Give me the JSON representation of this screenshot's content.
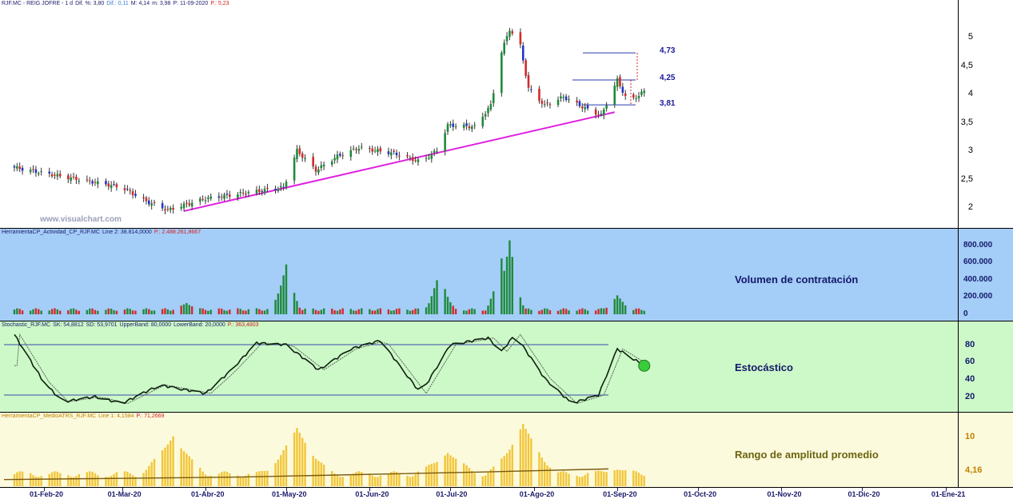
{
  "price_panel": {
    "header": [
      {
        "text": "RJF.MC - REIG JOFRE - 1 d",
        "color": "#1a1a6a"
      },
      {
        "text": "Dif. %: 3,80",
        "color": "#1a1a6a"
      },
      {
        "text": "Dif.: 0,11",
        "color": "#3a7ad0"
      },
      {
        "text": "M: 4,14",
        "color": "#1a1a6a"
      },
      {
        "text": "m: 3,98",
        "color": "#1a1a6a"
      },
      {
        "text": "P: 11-09-2020",
        "color": "#1a1a6a"
      },
      {
        "text": "P.: 5,23",
        "color": "#d02020"
      }
    ],
    "watermark": "www.visualchart.com",
    "levels": [
      "4,73",
      "4,25",
      "3,81"
    ],
    "y_ticks": [
      "5",
      "4,5",
      "4",
      "3,5",
      "3",
      "2,5",
      "2"
    ]
  },
  "volume_panel": {
    "header": [
      {
        "text": "HerramientaCP_Actividad_CP_RJF.MC",
        "color": "#1a1a6a"
      },
      {
        "text": "Line 2: 38.814,0000",
        "color": "#1a1a6a"
      },
      {
        "text": "P.: 2.488.261,8667",
        "color": "#d02020"
      }
    ],
    "title": "Volumen de contratación",
    "y_ticks": [
      "800.000",
      "600.000",
      "400.000",
      "200.000",
      "0"
    ]
  },
  "stoch_panel": {
    "header": [
      {
        "text": "Stochastic_RJF.MC",
        "color": "#1a1a6a"
      },
      {
        "text": "SK: 54,8812",
        "color": "#1a1a6a"
      },
      {
        "text": "SD: 53,9701",
        "color": "#1a1a6a"
      },
      {
        "text": "UpperBand: 80,0000",
        "color": "#1a1a6a"
      },
      {
        "text": "LowerBand: 20,0000",
        "color": "#1a1a6a"
      },
      {
        "text": "P.: 363,4803",
        "color": "#d02020"
      }
    ],
    "title": "Estocástico",
    "y_ticks": [
      "80",
      "60",
      "40",
      "20"
    ]
  },
  "atr_panel": {
    "header": [
      {
        "text": "HerramientaCP_MedioATRS_RJF.MC",
        "color": "#c08000"
      },
      {
        "text": "Line 1: 4,1584",
        "color": "#c08000"
      },
      {
        "text": "P.: 71,2669",
        "color": "#d02020"
      }
    ],
    "title": "Rango de amplitud promedio",
    "y_ticks": [
      "10",
      "4,16"
    ]
  },
  "x_axis": {
    "labels": [
      "01-Feb-20",
      "01-Mar-20",
      "01-Abr-20",
      "01-May-20",
      "01-Jun-20",
      "01-Jul-20",
      "01-Ago-20",
      "01-Sep-20",
      "01-Oct-20",
      "01-Nov-20",
      "01-Dic-20",
      "01-Ene-21"
    ],
    "year_marker": "2021"
  },
  "chart_data": [
    {
      "type": "candlestick",
      "title": "RJF.MC - REIG JOFRE - 1 d",
      "xlabel": "",
      "ylabel": "",
      "ylim": [
        1.7,
        5.3
      ],
      "x_range": [
        "2020-01-21",
        "2020-09-11"
      ],
      "close_path": [
        [
          "2020-01-21",
          2.7
        ],
        [
          "2020-02-01",
          2.6
        ],
        [
          "2020-02-15",
          2.48
        ],
        [
          "2020-03-01",
          2.35
        ],
        [
          "2020-03-10",
          2.1
        ],
        [
          "2020-03-18",
          1.95
        ],
        [
          "2020-04-01",
          2.15
        ],
        [
          "2020-04-20",
          2.28
        ],
        [
          "2020-04-30",
          2.35
        ],
        [
          "2020-05-05",
          3.0
        ],
        [
          "2020-05-12",
          2.65
        ],
        [
          "2020-05-20",
          2.9
        ],
        [
          "2020-05-28",
          3.05
        ],
        [
          "2020-06-10",
          2.95
        ],
        [
          "2020-06-20",
          2.8
        ],
        [
          "2020-06-26",
          3.0
        ],
        [
          "2020-06-30",
          3.45
        ],
        [
          "2020-07-10",
          3.42
        ],
        [
          "2020-07-16",
          3.8
        ],
        [
          "2020-07-20",
          4.75
        ],
        [
          "2020-07-23",
          5.15
        ],
        [
          "2020-07-27",
          4.85
        ],
        [
          "2020-07-30",
          4.1
        ],
        [
          "2020-08-05",
          3.8
        ],
        [
          "2020-08-12",
          3.95
        ],
        [
          "2020-08-20",
          3.75
        ],
        [
          "2020-08-26",
          3.62
        ],
        [
          "2020-09-01",
          4.25
        ],
        [
          "2020-09-05",
          3.85
        ],
        [
          "2020-09-11",
          4.05
        ]
      ],
      "trendline": [
        [
          "2020-03-24",
          1.93
        ],
        [
          "2020-08-31",
          3.68
        ]
      ],
      "levels": [
        4.73,
        4.25,
        3.81
      ],
      "y_ticks": [
        5,
        4.5,
        4,
        3.5,
        3,
        2.5,
        2
      ]
    },
    {
      "type": "bar",
      "title": "Volumen de contratación",
      "ylim": [
        0,
        900000
      ],
      "y_ticks": [
        800000,
        600000,
        400000,
        200000,
        0
      ],
      "spikes": [
        [
          "2020-03-25",
          130000
        ],
        [
          "2020-05-01",
          580000
        ],
        [
          "2020-06-27",
          500000
        ],
        [
          "2020-07-20",
          650000
        ],
        [
          "2020-07-23",
          860000
        ],
        [
          "2020-09-01",
          220000
        ]
      ],
      "baseline": 40000
    },
    {
      "type": "line",
      "title": "Estocástico",
      "ylim": [
        0,
        100
      ],
      "bands": [
        80,
        20
      ],
      "sk_last": 54.8812,
      "sd_last": 53.9701,
      "path": [
        [
          "2020-01-21",
          92
        ],
        [
          "2020-02-01",
          35
        ],
        [
          "2020-02-08",
          12
        ],
        [
          "2020-02-20",
          18
        ],
        [
          "2020-03-01",
          10
        ],
        [
          "2020-03-15",
          32
        ],
        [
          "2020-04-01",
          22
        ],
        [
          "2020-04-10",
          48
        ],
        [
          "2020-04-20",
          82
        ],
        [
          "2020-05-01",
          80
        ],
        [
          "2020-05-13",
          50
        ],
        [
          "2020-05-25",
          75
        ],
        [
          "2020-06-05",
          85
        ],
        [
          "2020-06-20",
          22
        ],
        [
          "2020-07-01",
          80
        ],
        [
          "2020-07-15",
          88
        ],
        [
          "2020-07-20",
          72
        ],
        [
          "2020-07-25",
          92
        ],
        [
          "2020-08-05",
          40
        ],
        [
          "2020-08-15",
          10
        ],
        [
          "2020-08-25",
          20
        ],
        [
          "2020-09-01",
          75
        ],
        [
          "2020-09-11",
          55
        ]
      ]
    },
    {
      "type": "bar",
      "title": "Rango de amplitud promedio",
      "line_last": 4.1584,
      "spikes": [
        [
          "2020-03-20",
          12
        ],
        [
          "2020-05-05",
          14
        ],
        [
          "2020-06-30",
          8
        ],
        [
          "2020-07-28",
          15
        ],
        [
          "2020-09-01",
          4
        ]
      ],
      "y_ticks": [
        10,
        4.16
      ]
    }
  ],
  "colors": {
    "price_bg": "#ffffff",
    "volume_bg": "#a4cdf8",
    "stoch_bg": "#cdf8c8",
    "atr_bg": "#fcfadc",
    "trendline": "#e020e0",
    "candle_up": "#1f8a3a",
    "candle_down_red": "#d22a2a",
    "candle_down_blue": "#2436c8",
    "atr_bar": "#f2c63a"
  }
}
